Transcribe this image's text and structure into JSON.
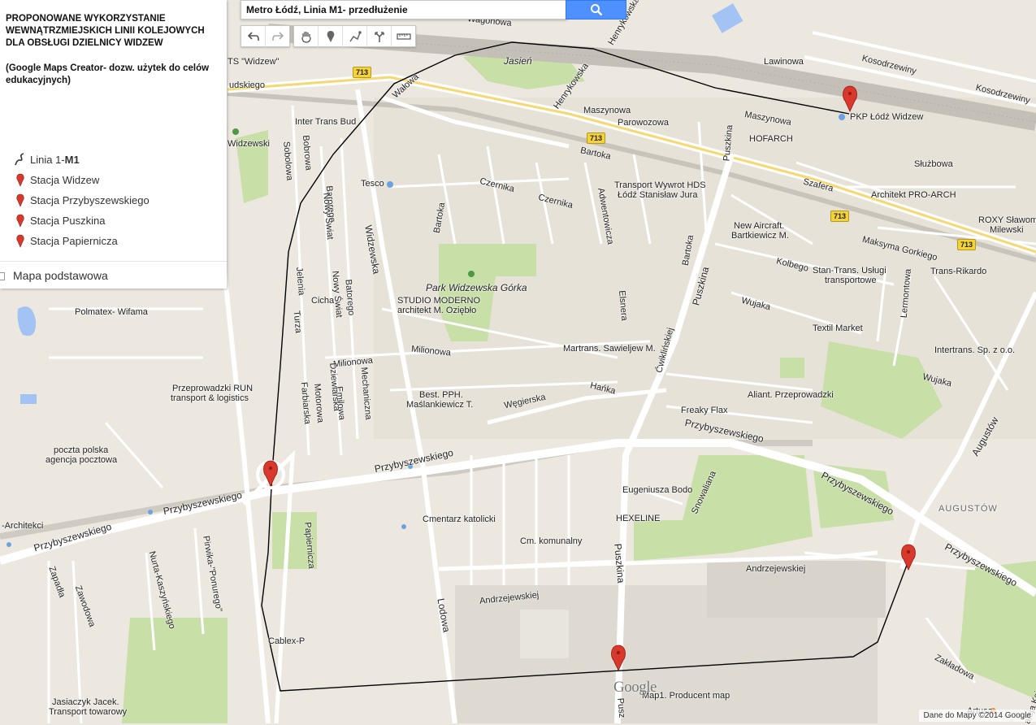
{
  "search": {
    "query": "Metro Łódź, Linia M1- przedłużenie",
    "icon": "search-icon"
  },
  "toolbar": {
    "icons": [
      "undo-icon",
      "redo-icon",
      "hand-icon",
      "marker-icon",
      "polyline-icon",
      "route-icon",
      "ruler-icon"
    ]
  },
  "panel": {
    "title": "PROPONOWANE WYKORZYSTANIE WEWNĄTRZMIEJSKICH LINII KOLEJOWYCH DLA OBSŁUGI DZIELNICY WIDZEW",
    "note": "(Google Maps Creator- dozw. użytek do celów edukacyjnych)",
    "line_label_prefix": "Linia 1- ",
    "line_label_bold": "M1",
    "stations": [
      "Stacja Widzew",
      "Stacja Przybyszewskiego",
      "Stacja Puszkina",
      "Stacja Papiernicza"
    ],
    "basemap": "Mapa podstawowa"
  },
  "colors": {
    "marker": "#d9382c",
    "route_line": "#000000",
    "road_major": "#ffffff",
    "park": "#c8dfa8",
    "badge": "#f4d23a"
  },
  "map_labels": {
    "lawinowa": "Lawinowa",
    "kosodrzewiny1": "Kosodrzewiny",
    "kosodrzewiny2": "Kosodrzewiny",
    "wagonowa": "Wagonowa",
    "henrykowska1": "Henrykowska",
    "henrykowska2": "Henrykowska",
    "jasien": "Jasień",
    "widzew_ts": "TS \"Widzew\"",
    "udskiego": "udskiego",
    "walowa": "Wałowa",
    "maszynowa1": "Maszynowa",
    "maszynowa2": "Maszynowa",
    "parowozowa": "Parowozowa",
    "pkp": "PKP Łódź Widzew",
    "intertrans": "Inter Trans Bud",
    "hofarch": "HOFARCH",
    "bartoka1": "Bartoka",
    "bartoka2": "Bartoka",
    "bartoka3": "Bartoka",
    "widzewski": "Widzewski",
    "sobolowa": "Sobolowa",
    "bobrowa": "Bobrowa",
    "tesco": "Tesco",
    "czernika1": "Czernika",
    "czernika2": "Czernika",
    "adwentowicza": "Adwentowicza",
    "transport_hds": "Transport Wywrot HDS",
    "lodz_jura": "Łódź Stanisław Jura",
    "sluzbowa": "Służbowa",
    "szafera": "Szafera",
    "pro_arch": "Architekt PRO-ARCH",
    "roxy": "ROXY Sławomir",
    "milewski": "Milewski",
    "barorego": "Barorego",
    "nowy_swiat1": "Nowy Świat",
    "nowy_swiat2": "Nowy Świat",
    "widzewska": "Widzewska",
    "new_aircraft": "New Aircraft.",
    "bartkiewicz": "Bartkiewicz M.",
    "maksyma": "Maksyma Gorkiego",
    "kolbego": "Kolbego",
    "stan_trans1": "Stan-Trans. Usługi",
    "stan_trans2": "transportowe",
    "trans_rikardo": "Trans-Rikardo",
    "jelenia": "Jelenia",
    "batorego": "Batorego",
    "turza": "Turza",
    "cicha": "Cicha",
    "park_gorka": "Park Widzewska Górka",
    "studio1": "STUDIO MODERNO",
    "studio2": "architekt M. Oziębło",
    "elsnera": "Elsnera",
    "puszkina1": "Puszkina",
    "puszkina2": "Puszkina",
    "puszkina3": "Puszkina",
    "wujaka1": "Wujaka",
    "wujaka2": "Wujaka",
    "lermontowa": "Lermontowa",
    "textil": "Textil Market",
    "milionowa1": "Milionowa",
    "milionowa2": "Milionowa",
    "martrans": "Martrans. Sawieljew M.",
    "cwiklinskiej": "Ćwiklińskiej",
    "intertrans_spz": "Intertrans. Sp. z o.o.",
    "polmatex": "Polmatex- Wifama",
    "przeprowadzki1": "Przeprowadzki RUN",
    "przeprowadzki2": "transport & logistics",
    "best1": "Best. PPH.",
    "best2": "Maślankiewicz T.",
    "emiliowa": "Emilowa",
    "dziewiarska": "Dziewiarska",
    "motorowa": "Motorowa",
    "farbiarska": "Farbiarska",
    "mechaniczna": "Mechaniczna",
    "hanka": "Hańka",
    "wegierska": "Węgierska",
    "aliant": "Aliant. Przeprowadzki",
    "freaky": "Freaky Flax",
    "augustow1": "Augustów",
    "augustow2": "AUGUSTÓW",
    "poczta1": "poczta polska",
    "poczta2": "agencja pocztowa",
    "przyb1": "Przybyszewskiego",
    "przyb2": "Przybyszewskiego",
    "przyb3": "Przybyszewskiego",
    "przyb4": "Przybyszewskiego",
    "przyb5": "Przybyszewskiego",
    "przyb6": "Przybyszewskiego",
    "architekci": "-Architekci",
    "snowalniana": "Snowaliana",
    "eugeniusza": "Eugeniusza Bodo",
    "hexeline": "HEXELINE",
    "cmentarz": "Cmentarz katolicki",
    "cm_komunalny": "Cm. komunalny",
    "papiernicza": "Papiernicza",
    "andrzejewska1": "Andrzejewskiej",
    "andrzejewska2": "Andrzejewskiej",
    "lodowa": "Lodowa",
    "zapadla": "Zapadła",
    "zawodowa": "Zawodowa",
    "nurta": "Nurta-Kaszyńskiego",
    "ponurego": "Pirwika-\"Ponurego\"",
    "cablex": "Cablex-P",
    "zakladowa": "Zakładowa",
    "aleja": "aleja Książąt P",
    "jasiaczyk1": "Jasiaczyk Jacek.",
    "jasiaczyk2": "Transport towarowy",
    "map1": "Map1. Producent map",
    "artusa": "Artusa",
    "puszkina_bottom": "Pusz"
  },
  "badges": [
    "713",
    "713",
    "713",
    "713"
  ],
  "footer": {
    "logo": "Google",
    "data": "Dane do Mapy ©2014 Google"
  }
}
